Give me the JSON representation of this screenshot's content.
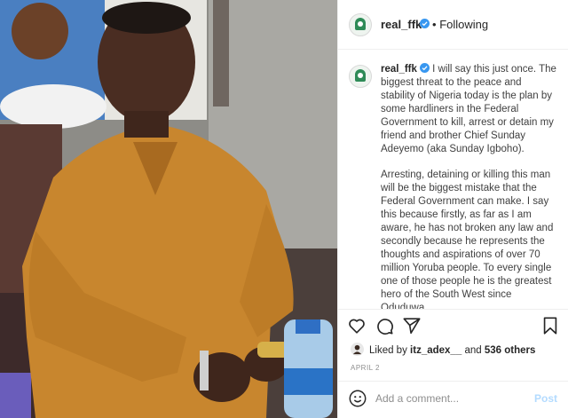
{
  "post": {
    "username": "real_ffk",
    "follow_status": "Following",
    "separator": "•",
    "caption_paragraphs": [
      "I will say this just once. The biggest threat to the peace and stability of Nigeria today is the plan by some hardliners in the Federal Government to kill, arrest or detain my friend and brother Chief Sunday Adeyemo (aka Sunday Igboho).",
      "Arresting, detaining or killing this man will be the biggest mistake that the Federal Government can make. I say this because firstly, as far as I am aware, he has not broken any law and secondly because he represents the thoughts and aspirations of over 70 million Yoruba people. To every single one of those people he is the greatest hero of the South West since Oduduwa."
    ],
    "likes": {
      "prefix": "Liked by",
      "liker": "itz_adex__",
      "joiner": "and",
      "others": "536 others"
    },
    "date": "APRIL 2",
    "comment_placeholder": "Add a comment...",
    "post_button": "Post"
  },
  "icons": {
    "verified": "verified-badge-icon",
    "more": "more-options-icon",
    "like": "heart-icon",
    "comment": "comment-icon",
    "share": "paper-plane-icon",
    "save": "bookmark-icon",
    "emoji": "smiley-icon"
  },
  "colors": {
    "verified_blue": "#3897f0",
    "post_button_disabled": "#b3dbff",
    "secondary_text": "#8e8e8e",
    "robe": "#c8862e"
  }
}
